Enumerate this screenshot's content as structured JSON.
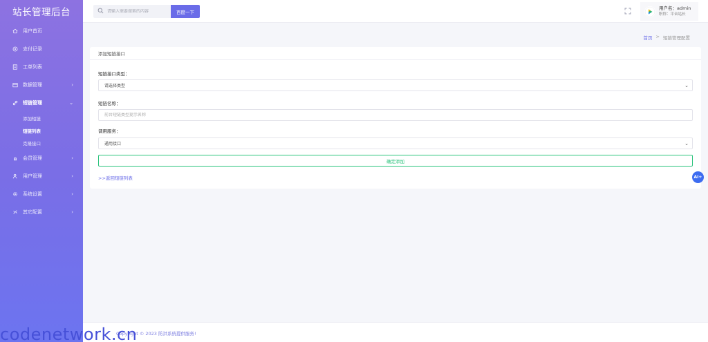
{
  "sidebar": {
    "brand": "站长管理后台",
    "items": [
      {
        "label": "用户首页",
        "icon": "home-icon"
      },
      {
        "label": "支付记录",
        "icon": "pay-icon"
      },
      {
        "label": "工单列表",
        "icon": "ticket-icon"
      },
      {
        "label": "数据管理",
        "icon": "data-icon",
        "chevron": "›"
      },
      {
        "label": "短链管理",
        "icon": "link-icon",
        "chevron": "⌄",
        "active": true,
        "children": [
          {
            "label": "添加短链"
          },
          {
            "label": "短链列表",
            "current": true
          },
          {
            "label": "克隆接口"
          }
        ]
      },
      {
        "label": "会员管理",
        "icon": "member-icon",
        "chevron": "›"
      },
      {
        "label": "用户管理",
        "icon": "user-icon",
        "chevron": "›"
      },
      {
        "label": "系统设置",
        "icon": "settings-icon",
        "chevron": "›"
      },
      {
        "label": "其它配置",
        "icon": "config-icon",
        "chevron": "›"
      }
    ]
  },
  "header": {
    "search_placeholder": "请输入需要搜索的内容",
    "search_button": "百度一下",
    "user_name": "用户名：admin",
    "user_role": "职称：平台站长"
  },
  "breadcrumb": {
    "home": "首页",
    "sep": ">",
    "current": "短链管理配置"
  },
  "form": {
    "card_title": "添加短链接口",
    "type_label": "短链接口类型：",
    "type_value": "请选择类型",
    "name_label": "短链名称：",
    "name_placeholder": "前台短链类型提示名称",
    "service_label": "调用服务：",
    "service_value": "通用接口",
    "submit": "确定添加",
    "back_link": ">>返回短链列表"
  },
  "fab": {
    "label": "AI+"
  },
  "footer": {
    "text": "Copyright © 2023 防洪系统提供服务!"
  },
  "watermark": "codenetwork.cn",
  "colors": {
    "sidebar_gradient_top": "#8d72e1",
    "sidebar_gradient_bottom": "#6c74f0",
    "accent": "#6a6ce8",
    "success": "#27c27a",
    "fab": "#3d6cf0"
  }
}
